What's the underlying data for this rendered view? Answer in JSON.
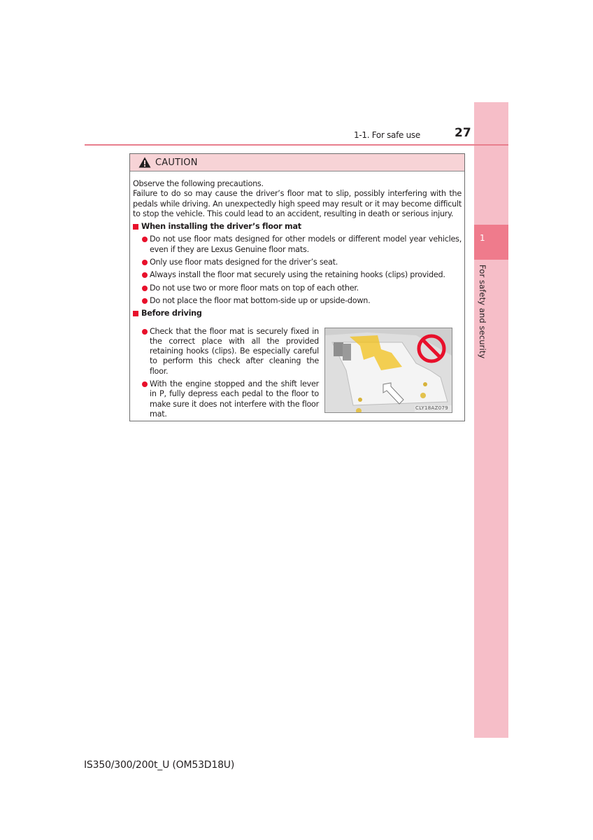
{
  "header": {
    "section": "1-1. For safe use",
    "page_number": "27"
  },
  "side_tab": {
    "chapter_number": "1",
    "chapter_title": "For safety and security"
  },
  "caution": {
    "icon": "warning-triangle-icon",
    "title": "CAUTION",
    "intro_line1": "Observe the following precautions.",
    "intro_line2": "Failure to do so may cause the driver’s floor mat to slip, possibly interfering with the pedals while driving. An unexpectedly high speed may result or it may become difficult to stop the vehicle. This could lead to an accident, resulting in death or serious injury.",
    "sections": [
      {
        "heading": "When installing the driver’s floor mat",
        "bullets": [
          "Do not use floor mats designed for other models or different model year vehicles, even if they are Lexus Genuine floor mats.",
          "Only use floor mats designed for the driver’s seat.",
          "Always install the floor mat securely using the retaining hooks (clips) provided.",
          "Do not use two or more floor mats on top of each other.",
          "Do not place the floor mat bottom-side up or upside-down."
        ]
      },
      {
        "heading": "Before driving",
        "bullets": [
          "Check that the floor mat is securely fixed in the correct place with all the provided retaining hooks (clips). Be especially careful to perform this check after cleaning the floor.",
          "With the engine stopped and the shift lever in P, fully depress each pedal to the floor to make sure it does not interfere with the floor mat."
        ]
      }
    ],
    "figure": {
      "description": "Floor mat under pedals with prohibition symbol and arrow",
      "code": "CLY18AZ079",
      "colors": {
        "prohibit": "#e8102b",
        "pedal_highlight": "#f3c21b"
      }
    }
  },
  "footer": {
    "model_code": "IS350/300/200t_U (OM53D18U)"
  },
  "colors": {
    "accent_red": "#e8102b",
    "tab_pink": "#f6bec8",
    "tab_active": "#ef7b8c",
    "rule": "#e87f8e",
    "caution_bg": "#f7d3d6"
  }
}
